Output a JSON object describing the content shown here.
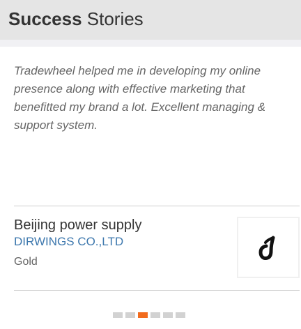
{
  "header": {
    "title_bold": "Success",
    "title_regular": "Stories"
  },
  "testimonial": {
    "quote": "Tradewheel helped me in developing my online presence along with effective marketing that benefitted my brand a lot. Excellent managing & support system.",
    "company": "Beijing power supply",
    "vendor": "DIRWINGS CO.,LTD",
    "membership": "Gold",
    "logo_icon": "dirwings-logo-icon"
  },
  "pagination": {
    "count": 6,
    "active_index": 2
  },
  "colors": {
    "header_background": "#e5e5e5",
    "vendor_link": "#3c77ad",
    "active_dot": "#f26b1d",
    "inactive_dot": "#d2d2d2"
  }
}
